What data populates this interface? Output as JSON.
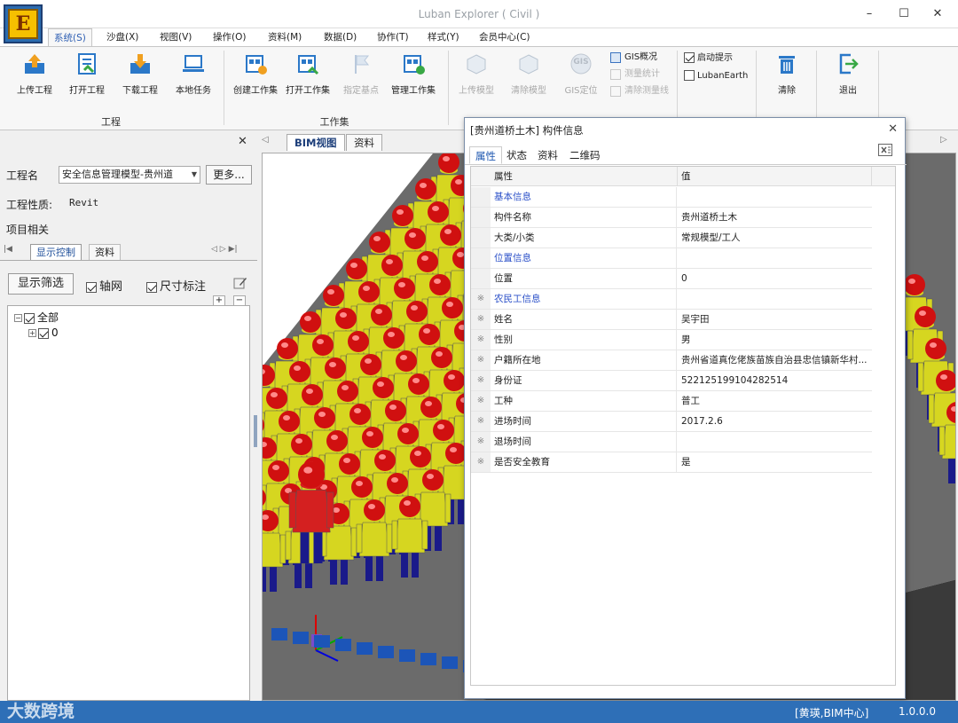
{
  "window": {
    "title": "Luban Explorer ( Civil )",
    "min_glyph": "–",
    "max_glyph": "☐",
    "close_glyph": "✕"
  },
  "app_logo": {
    "letter": "E"
  },
  "menu": [
    "系统(S)",
    "沙盘(X)",
    "视图(V)",
    "操作(O)",
    "资料(M)",
    "数据(D)",
    "协作(T)",
    "样式(Y)",
    "会员中心(C)"
  ],
  "ribbon": {
    "groups": {
      "project": "工程",
      "workset": "工作集"
    },
    "buttons": {
      "upload": "上传工程",
      "open": "打开工程",
      "download": "下载工程",
      "local": "本地任务",
      "create_ws": "创建工作集",
      "open_ws": "打开工作集",
      "base_point": "指定基点",
      "manage_ws": "管理工作集",
      "upload_model": "上传模型",
      "clear_model": "清除模型",
      "gis_locate": "GIS定位",
      "gis_overview": "GIS概况",
      "measure_stats": "测量统计",
      "clear_measure": "清除测量线",
      "startup_tip": "启动提示",
      "luban_earth": "LubanEarth",
      "clear": "清除",
      "exit": "退出"
    },
    "gis_label": "GIS"
  },
  "left": {
    "project_label": "工程名",
    "project_value": "安全信息管理模型-贵州道",
    "more_btn": "更多...",
    "nature_label": "工程性质:",
    "nature_value": "Revit",
    "related_label": "项目相关",
    "tabs": [
      "显示控制",
      "资料"
    ],
    "filter_btn": "显示筛选",
    "axis_net": "轴网",
    "dim_label": "尺寸标注",
    "plus": "+",
    "minus": "−",
    "tree": {
      "root": "全部",
      "child": "0"
    }
  },
  "view_tabs": [
    "BIM视图",
    "资料"
  ],
  "dialog": {
    "title": "[贵州道桥土木] 构件信息",
    "close_glyph": "✕",
    "tabs": [
      "属性",
      "状态",
      "资料",
      "二维码"
    ],
    "col_attr": "属性",
    "col_value": "值",
    "rows": [
      {
        "mark": "",
        "key": "基本信息",
        "value": "",
        "cat": true
      },
      {
        "mark": "",
        "key": "构件名称",
        "value": "贵州道桥土木",
        "cat": false
      },
      {
        "mark": "",
        "key": "大类/小类",
        "value": "常规模型/工人",
        "cat": false
      },
      {
        "mark": "",
        "key": "位置信息",
        "value": "",
        "cat": true
      },
      {
        "mark": "",
        "key": "位置",
        "value": "0",
        "cat": false
      },
      {
        "mark": "※",
        "key": "农民工信息",
        "value": "",
        "cat": true
      },
      {
        "mark": "※",
        "key": "姓名",
        "value": "吴宇田",
        "cat": false
      },
      {
        "mark": "※",
        "key": "性别",
        "value": "男",
        "cat": false
      },
      {
        "mark": "※",
        "key": "户籍所在地",
        "value": "贵州省道真仡佬族苗族自治县忠信镇新华村...",
        "cat": false
      },
      {
        "mark": "※",
        "key": "身份证",
        "value": "522125199104282514",
        "cat": false
      },
      {
        "mark": "※",
        "key": "工种",
        "value": "普工",
        "cat": false
      },
      {
        "mark": "※",
        "key": "进场时间",
        "value": "2017.2.6",
        "cat": false
      },
      {
        "mark": "※",
        "key": "退场时间",
        "value": "",
        "cat": false
      },
      {
        "mark": "※",
        "key": "是否安全教育",
        "value": "是",
        "cat": false
      }
    ]
  },
  "status": {
    "user": "[黄瑛,BIM中心]",
    "version": "1.0.0.0"
  },
  "watermark": "大数跨境",
  "colors": {
    "accent": "#2e6fb7",
    "worker_body": "#d6d620",
    "worker_legs": "#1a1a8a",
    "helmet": "#d01010",
    "selected": "#d42020"
  }
}
